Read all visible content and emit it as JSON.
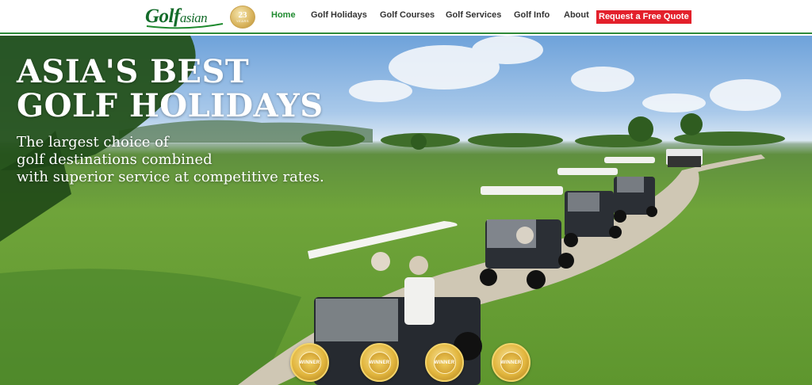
{
  "header": {
    "logo_main": "Golf",
    "logo_small": "asian",
    "years_badge": {
      "number": "23",
      "label": "YEARS"
    },
    "nav": [
      {
        "label": "Home",
        "active": true
      },
      {
        "label": "Golf Holidays",
        "active": false
      },
      {
        "label": "Golf Courses",
        "active": false
      },
      {
        "label": "Golf Services",
        "active": false
      },
      {
        "label": "Golf Info",
        "active": false
      },
      {
        "label": "About",
        "active": false
      }
    ],
    "quote_button": "Request a Free Quote"
  },
  "hero": {
    "title_line1": "ASIA'S BEST",
    "title_line2": "GOLF HOLIDAYS",
    "sub_line1": "The largest choice of",
    "sub_line2": "golf destinations combined",
    "sub_line3": "with superior service at competitive rates.",
    "award_label": "WINNER",
    "awards_count": 4
  },
  "colors": {
    "brand_green": "#1e8a2e",
    "quote_red": "#e3202b",
    "gold": "#e2b63e"
  }
}
